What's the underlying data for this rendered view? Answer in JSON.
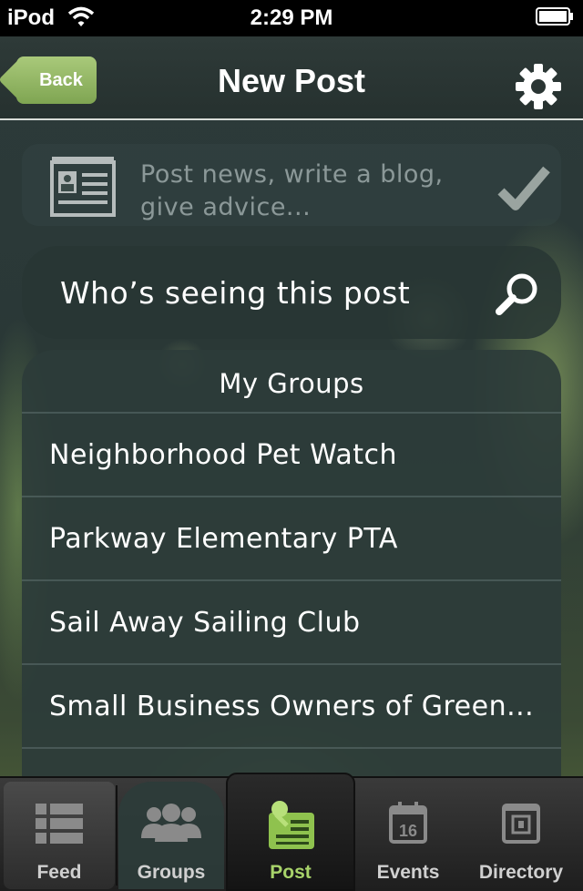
{
  "statusbar": {
    "carrier": "iPod",
    "time": "2:29 PM"
  },
  "navbar": {
    "back_label": "Back",
    "title": "New Post",
    "settings_icon": "gear-icon"
  },
  "compose": {
    "placeholder": "Post news, write a blog, give advice...",
    "icon": "newspaper-icon",
    "submit_icon": "checkmark-icon"
  },
  "audience": {
    "label": "Who’s seeing this post",
    "icon": "search-icon"
  },
  "groups": {
    "header": "My Groups",
    "items": [
      {
        "label": "Neighborhood Pet Watch"
      },
      {
        "label": "Parkway Elementary PTA"
      },
      {
        "label": "Sail Away Sailing Club"
      },
      {
        "label": "Small Business Owners of Green..."
      }
    ]
  },
  "tabbar": {
    "tabs": [
      {
        "label": "Feed",
        "icon": "feed-icon"
      },
      {
        "label": "Groups",
        "icon": "people-icon"
      },
      {
        "label": "Post",
        "icon": "post-pin-icon",
        "selected": true
      },
      {
        "label": "Events",
        "icon": "calendar-icon",
        "calendar_day": "16"
      },
      {
        "label": "Directory",
        "icon": "directory-icon"
      }
    ]
  },
  "colors": {
    "accent_green": "#a8d36a",
    "back_button": "#8fb660",
    "nav_background": "#2a3533"
  }
}
